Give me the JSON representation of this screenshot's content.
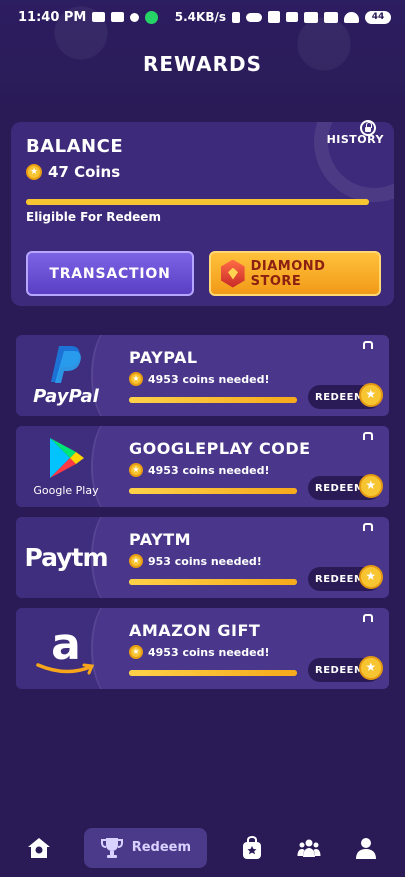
{
  "status_bar": {
    "time": "11:40 PM",
    "net_speed": "5.4KB/s",
    "battery": "44"
  },
  "header": {
    "title": "REWARDS"
  },
  "balance": {
    "title": "BALANCE",
    "history_label": "HISTORY",
    "coins_text": "47 Coins",
    "progress": 1.0,
    "eligible_text": "Eligible For Redeem",
    "transaction_label": "TRANSACTION",
    "diamond_store_label": "DIAMOND STORE"
  },
  "rewards": [
    {
      "name": "PAYPAL",
      "coins_needed": "4953 coins needed!",
      "redeem_label": "REDEEM",
      "logo": "paypal-logo",
      "logo_text": "PayPal",
      "progress": 1.0
    },
    {
      "name": "GOOGLEPLAY CODE",
      "coins_needed": "4953 coins needed!",
      "redeem_label": "REDEEM",
      "logo": "google-play-logo",
      "logo_text": "Google Play",
      "progress": 1.0
    },
    {
      "name": "PAYTM",
      "coins_needed": "953 coins needed!",
      "redeem_label": "REDEEM",
      "logo": "paytm-logo",
      "logo_text": "Paytm",
      "progress": 1.0
    },
    {
      "name": "AMAZON GIFT",
      "coins_needed": "4953 coins needed!",
      "redeem_label": "REDEEM",
      "logo": "amazon-logo",
      "logo_text": "a",
      "progress": 1.0
    }
  ],
  "bottom_nav": {
    "items": [
      {
        "icon": "home-icon",
        "label": ""
      },
      {
        "icon": "trophy-icon",
        "label": "Redeem",
        "active": true
      },
      {
        "icon": "bag-icon",
        "label": ""
      },
      {
        "icon": "group-icon",
        "label": ""
      },
      {
        "icon": "user-icon",
        "label": ""
      }
    ]
  },
  "colors": {
    "background": "#2a1b57",
    "card": "#3d2a7a",
    "accent_gold": "#f7c531",
    "transaction_button": "#6a52d6",
    "diamond_button": "#f5a623"
  }
}
